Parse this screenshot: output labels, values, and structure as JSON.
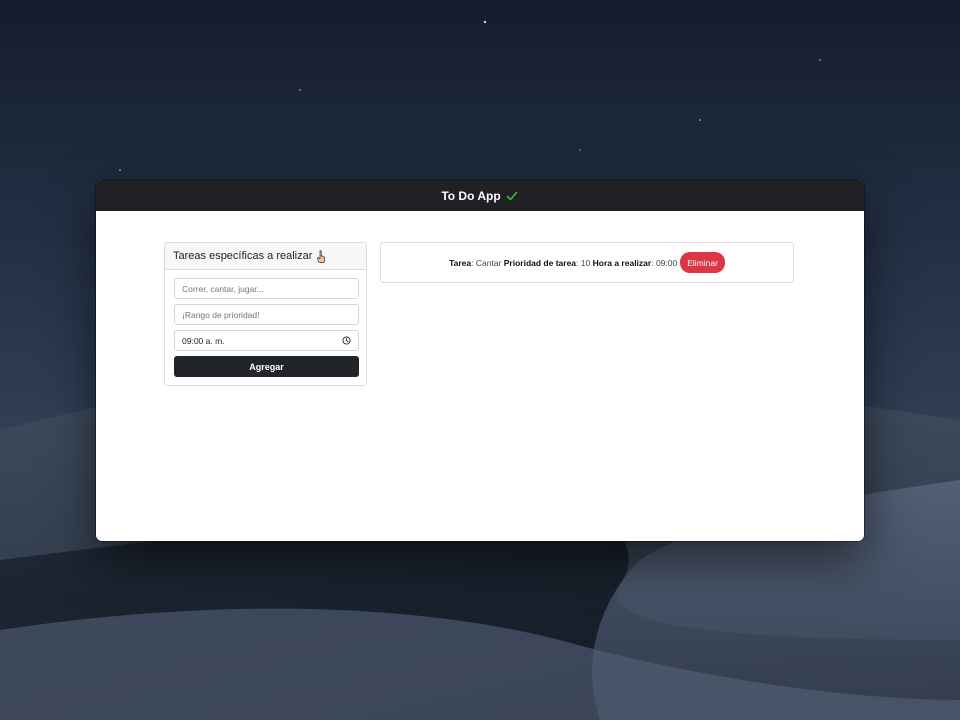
{
  "window": {
    "title": "To Do App"
  },
  "form": {
    "header": "Tareas específicas a realizar",
    "task_placeholder": "Correr, cantar, jugar...",
    "priority_placeholder": "¡Rango de prioridad!",
    "time_value": "09:00  a. m.",
    "submit_label": "Agregar"
  },
  "tasks": [
    {
      "task_label": "Tarea",
      "task_value": "Cantar",
      "priority_label": "Prioridad de tarea",
      "priority_value": "10",
      "time_label": "Hora a realizar",
      "time_value": "09:00",
      "delete_label": "Eliminar"
    }
  ],
  "colors": {
    "titlebar": "#202124",
    "check": "#2fbf3a",
    "primary_button": "#212529",
    "danger_button": "#dc3545"
  }
}
